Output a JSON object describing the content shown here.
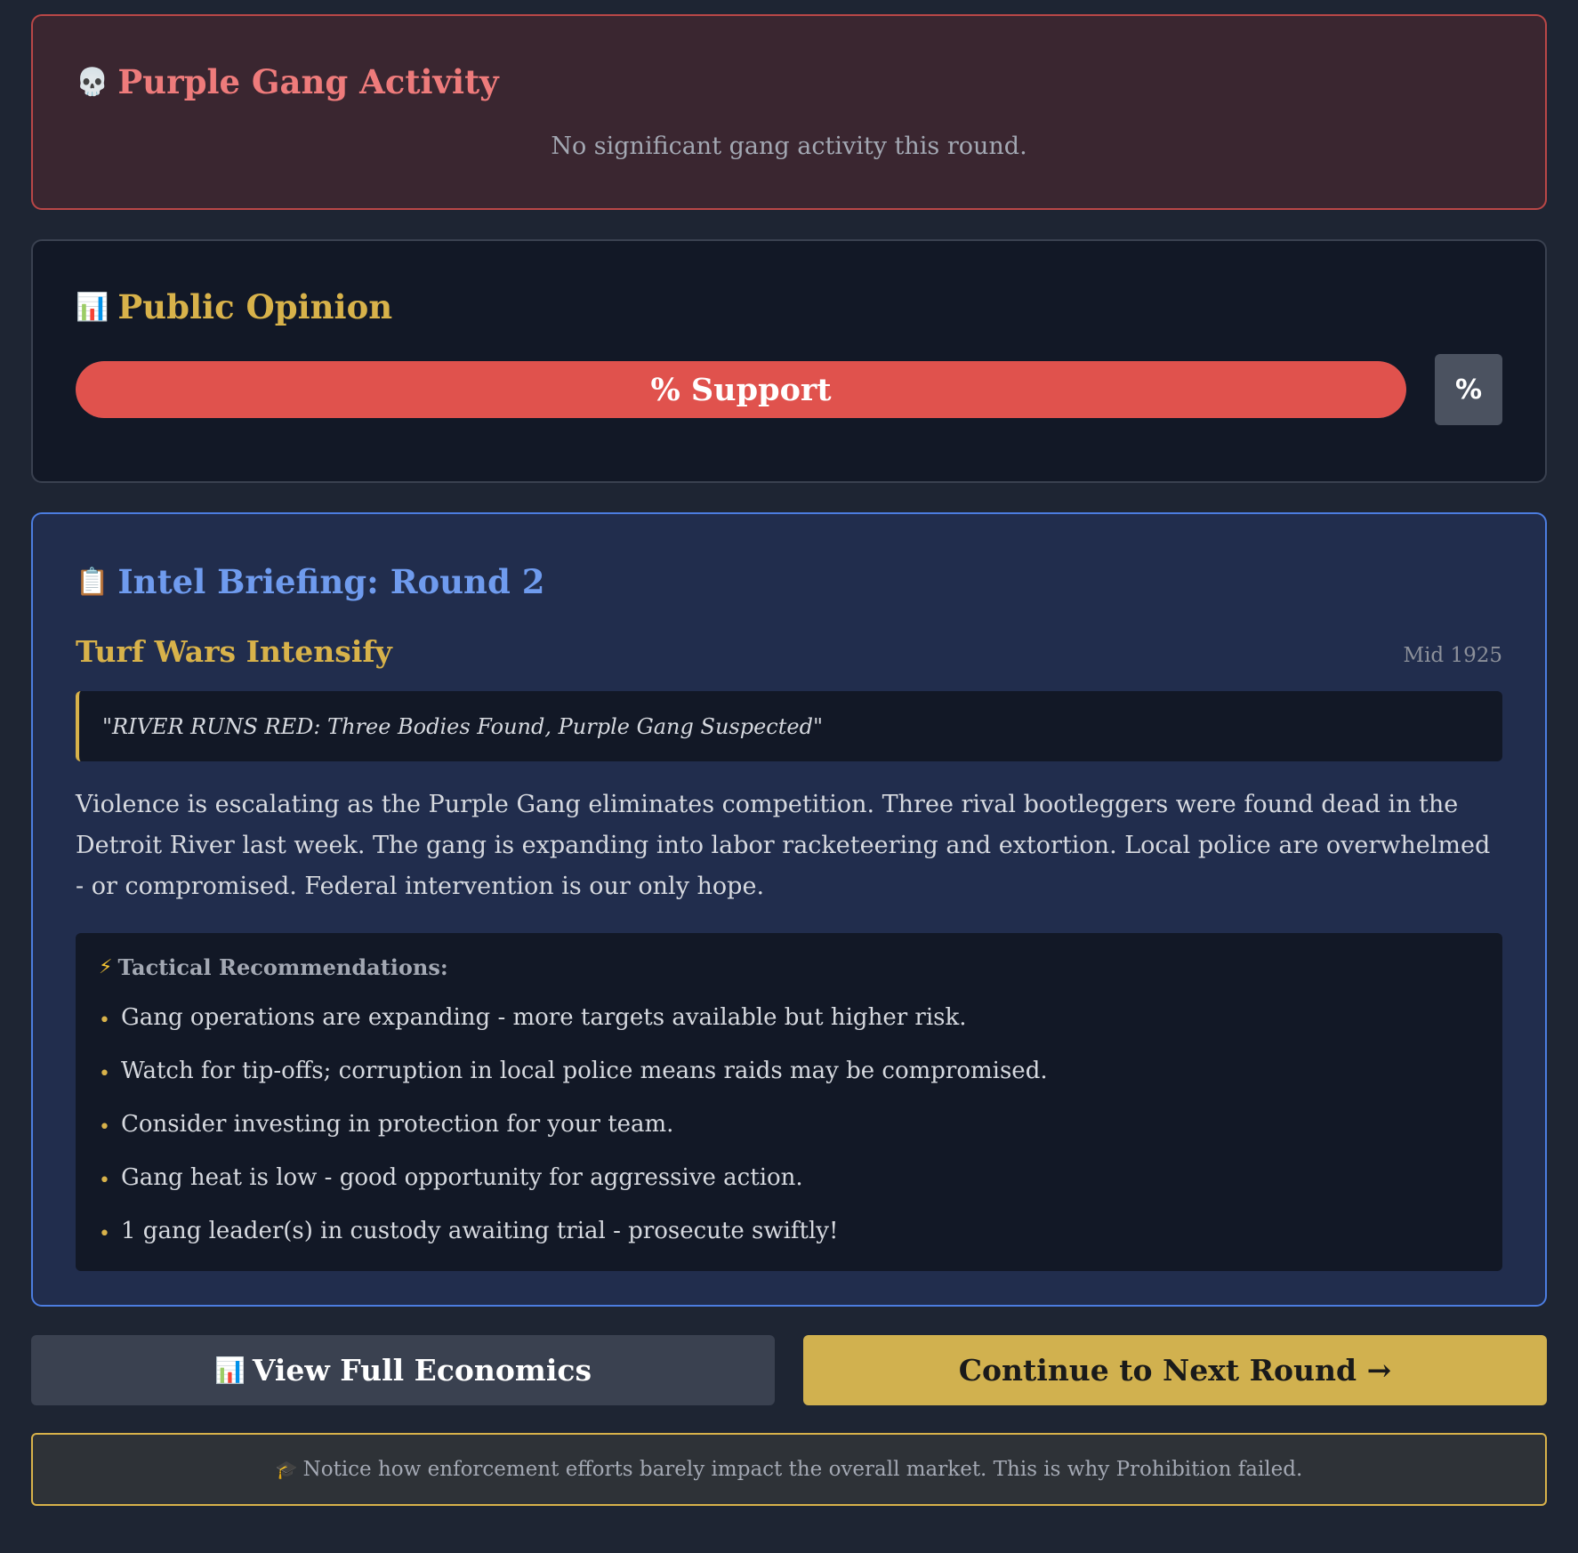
{
  "gang_panel": {
    "icon": "skull-icon",
    "icon_glyph": "💀",
    "title": "Purple Gang Activity",
    "message": "No significant gang activity this round."
  },
  "opinion_panel": {
    "icon": "bar-chart-icon",
    "icon_glyph": "📊",
    "title": "Public Opinion",
    "bar_label": "% Support",
    "badge": "%"
  },
  "intel_panel": {
    "icon": "clipboard-icon",
    "icon_glyph": "📋",
    "title": "Intel Briefing: Round 2",
    "headline": "Turf Wars Intensify",
    "date": "Mid 1925",
    "quote": "\"RIVER RUNS RED: Three Bodies Found, Purple Gang Suspected\"",
    "body": "Violence is escalating as the Purple Gang eliminates competition. Three rival bootleggers were found dead in the Detroit River last week. The gang is expanding into labor racketeering and extortion. Local police are overwhelmed - or compromised. Federal intervention is our only hope.",
    "tactics": {
      "icon": "lightning-icon",
      "icon_glyph": "⚡",
      "title": "Tactical Recommendations:",
      "items": [
        "Gang operations are expanding - more targets available but higher risk.",
        "Watch for tip-offs; corruption in local police means raids may be compromised.",
        "Consider investing in protection for your team.",
        "Gang heat is low - good opportunity for aggressive action.",
        "1 gang leader(s) in custody awaiting trial - prosecute swiftly!"
      ]
    }
  },
  "buttons": {
    "economics": {
      "icon": "bar-chart-icon",
      "icon_glyph": "📊",
      "label": "View Full Economics"
    },
    "next_round": {
      "label": "Continue to Next Round →"
    }
  },
  "notice": {
    "icon": "graduation-cap-icon",
    "icon_glyph": "🎓",
    "text": "Notice how enforcement efforts barely impact the overall market. This is why Prohibition failed."
  },
  "colors": {
    "background": "#1e2533",
    "gang_accent": "#ee7b7b",
    "gold_accent": "#d8b24a",
    "intel_accent": "#6f9bee",
    "support_bar": "#e0524d"
  }
}
